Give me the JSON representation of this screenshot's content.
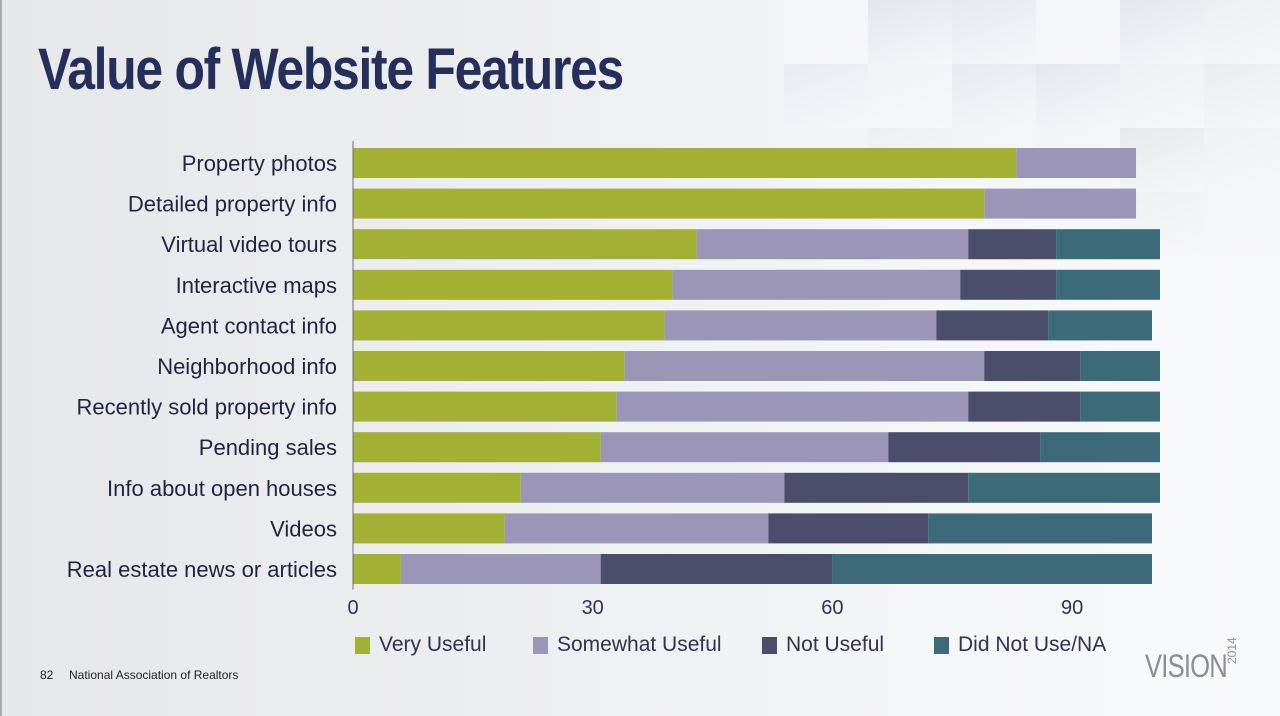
{
  "slide": {
    "title": "Value of Website Features",
    "page_number": "82",
    "organization": "National Association of Realtors",
    "brand": "VISION",
    "brand_year": "2014"
  },
  "colors": {
    "very_useful": "#a2b034",
    "somewhat_useful": "#9b96b8",
    "not_useful": "#4a4e6a",
    "did_not_use": "#3d6a78",
    "title": "#25305a"
  },
  "chart_data": {
    "type": "bar",
    "orientation": "horizontal",
    "stacked": true,
    "title": "Value of Website Features",
    "xlabel": "",
    "ylabel": "",
    "xlim": [
      0,
      100
    ],
    "xticks": [
      0,
      30,
      60,
      90
    ],
    "grid": false,
    "legend_position": "bottom",
    "categories": [
      "Property photos",
      "Detailed property info",
      "Virtual video tours",
      "Interactive maps",
      "Agent contact info",
      "Neighborhood info",
      "Recently sold property info",
      "Pending sales",
      "Info about open houses",
      "Videos",
      "Real estate news or articles"
    ],
    "series": [
      {
        "name": "Very Useful",
        "color_key": "very_useful",
        "values": [
          83,
          79,
          43,
          40,
          39,
          34,
          33,
          31,
          21,
          19,
          6
        ]
      },
      {
        "name": "Somewhat Useful",
        "color_key": "somewhat_useful",
        "values": [
          15,
          19,
          34,
          36,
          34,
          45,
          44,
          36,
          33,
          33,
          25
        ]
      },
      {
        "name": "Not Useful",
        "color_key": "not_useful",
        "values": [
          0,
          0,
          11,
          12,
          14,
          12,
          14,
          19,
          23,
          20,
          29
        ]
      },
      {
        "name": "Did Not Use/NA",
        "color_key": "did_not_use",
        "values": [
          0,
          0,
          13,
          13,
          13,
          10,
          10,
          15,
          24,
          28,
          40
        ]
      }
    ]
  }
}
